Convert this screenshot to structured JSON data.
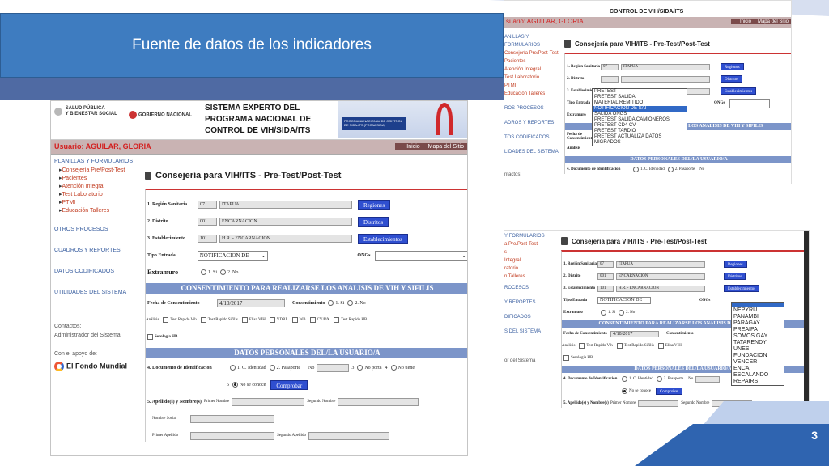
{
  "slide": {
    "title": "Fuente de datos de los indicadores",
    "page_number": "3"
  },
  "app": {
    "logo_ministry": [
      "SALUD PÚBLICA",
      "Y BIENESTAR SOCIAL"
    ],
    "logo_gov": "GOBIERNO NACIONAL",
    "system_title": [
      "SISTEMA EXPERTO DEL",
      "PROGRAMA NACIONAL DE",
      "CONTROL DE VIH/SIDA/ITS"
    ],
    "banner_label": "PROGRAMA NACIONAL DE CONTROL DE SIDA-ITS (PRONASIDA)",
    "user": "Usuario: AGUILAR, GLORIA",
    "nav_links": [
      "Inicio",
      "Mapa del Sitio"
    ]
  },
  "sidebar": {
    "groups": [
      "PLANILLAS Y FORMULARIOS",
      "OTROS PROCESOS",
      "CUADROS Y REPORTES",
      "DATOS CODIFICADOS",
      "UTILIDADES DEL SISTEMA"
    ],
    "items": [
      "Consejería Pre/Post-Test",
      "Pacientes",
      "Atención Integral",
      "Test Laboratorio",
      "PTMI",
      "Educación Talleres"
    ],
    "contacts_label": "Contactos:",
    "contacts_value": "Administrador del Sistema",
    "support_label": "Con el apoyo de:",
    "support_org": "El Fondo Mundial"
  },
  "form": {
    "page_title": "Consejería para VIH/ITS - Pre-Test/Post-Test",
    "region_label": "1. Región Sanitaria",
    "region_code": "07",
    "region_name": "ITAPUA",
    "region_btn": "Regiones",
    "distrito_label": "2. Distrito",
    "distrito_code": "001",
    "distrito_name": "ENCARNACION",
    "distrito_btn": "Distritos",
    "estab_label": "3. Establecimiento",
    "estab_code": "101",
    "estab_name": "H.R. - ENCARNACION",
    "estab_btn": "Establecimientos",
    "tipo_label": "Tipo Entrada",
    "tipo_value": "NOTIFICACION DE",
    "ongs_label": "ONGs",
    "extramuro_label": "Extramuro",
    "opt_si": "1. Si",
    "opt_no": "2. No",
    "section_consent": "CONSENTIMIENTO PARA REALIZARSE LOS ANALISIS DE VIH Y SIFILIS",
    "fecha_label": "Fecha de Consentimiento",
    "fecha_value": "4/10/2017",
    "consent_label": "Consentimiento",
    "analisis_label": "Análisis",
    "analisis_items": [
      "Test Rapido Vih",
      "Test Rapido Sifilis",
      "Elisa VIH",
      "VDRL",
      "WB",
      "CV/DX",
      "Test Rapido HB",
      "Serologia HB"
    ],
    "section_personal": "DATOS PERSONALES DEL/LA USUARIO/A",
    "doc_label": "4. Documento de Identificacion",
    "doc_opts": [
      "1. C. Identidad",
      "2. Pasaporte",
      "No",
      "3",
      "No porta",
      "4",
      "No tiene",
      "5",
      "No se conoce"
    ],
    "comprobar_btn": "Comprobar",
    "nombre_label": "5. Apellido(s) y Nombre(s)",
    "primer_nombre": "Primer Nombre",
    "segundo_nombre": "Segundo Nombre",
    "nombre_social": "Nombre Social",
    "primer_apellido": "Primer Apellido",
    "segundo_apellido": "Segundo Apellido"
  },
  "shot2": {
    "top_text": "CONTROL DE VIH/SIDA/ITS",
    "user": "suario: AGUILAR, GLORIA",
    "side": [
      "ANILLAS Y FORMULARIOS",
      "Consejería Pre/Post-Test",
      "Pacientes",
      "Atención Integral",
      "Test Laboratorio",
      "PTMI",
      "Educación Talleres",
      "ROS PROCESOS",
      "ADROS Y REPORTES",
      "TOS CODIFICADOS",
      "LIDADES DEL SISTEMA",
      "ntactos:"
    ],
    "dropdown": [
      "PRETEST",
      "PRETEST SALIDA",
      "MATERIAL REMITIDO",
      "NOTIFICACION DE SAI",
      "SALIDA ONGS",
      "PRETEST SALIDA CAMIONEROS",
      "PRETEST CD4 CV",
      "PRETEST TARDIO",
      "PRETEST ACTUALIZA DATOS MIGRADOS"
    ],
    "dropdown_selected_index": 3
  },
  "shot3": {
    "side": [
      "Y FORMULARIOS",
      "a Pre/Post-Test",
      "s",
      "Integral",
      "ratorio",
      "n Talleres",
      "ROCESOS",
      "Y REPORTES",
      "DIFICADOS",
      "S DEL SISTEMA",
      "or del Sistema"
    ],
    "ongs_dropdown": [
      "",
      "NEPYRU",
      "PANAMBI",
      "PARAGAY",
      "PREAIPA",
      "SOMOS GAY",
      "TATARENDY",
      "UNES",
      "FUNDACION VENCER",
      "ENCA",
      "ESCALANDO",
      "REPAIRS"
    ]
  }
}
